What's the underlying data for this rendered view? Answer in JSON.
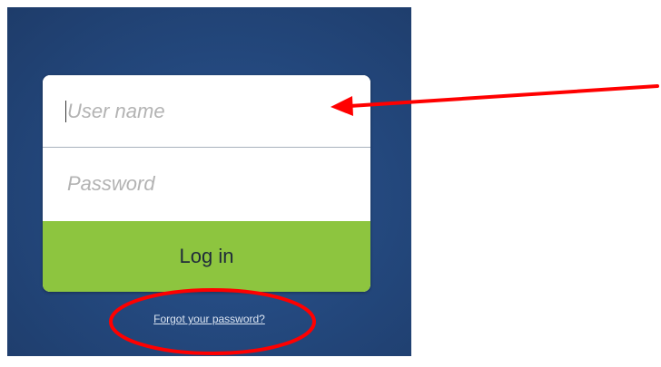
{
  "login_form": {
    "username_placeholder": "User name",
    "password_placeholder": "Password",
    "login_button_label": "Log in",
    "forgot_password_link": "Forgot your password?"
  },
  "colors": {
    "panel_background": "#24497f",
    "login_button": "#8dc53f",
    "annotation": "#ff0000"
  },
  "annotations": {
    "arrow_target": "username-field",
    "ellipse_target": "forgot-password-link"
  }
}
